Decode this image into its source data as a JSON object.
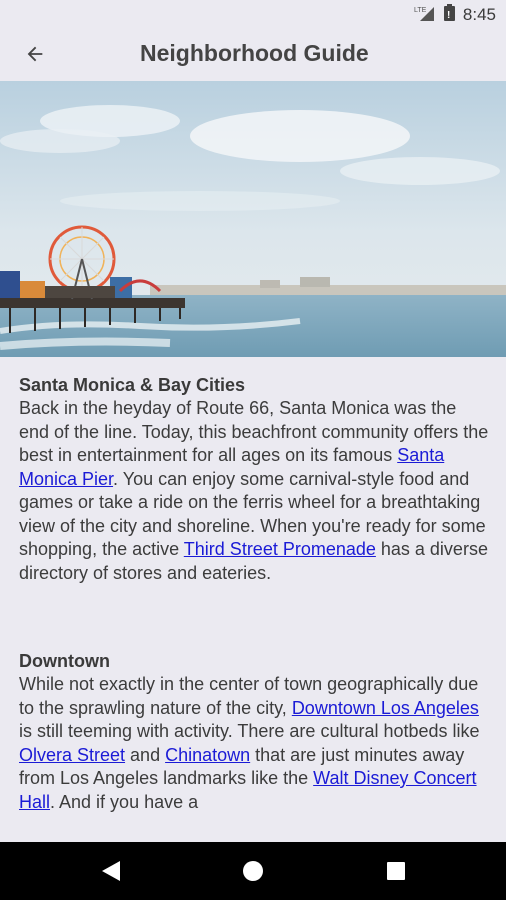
{
  "status_bar": {
    "time": "8:45",
    "icons": [
      "lte-signal-icon",
      "battery-icon"
    ]
  },
  "app_bar": {
    "title": "Neighborhood Guide",
    "back_icon": "arrow-back-icon"
  },
  "hero": {
    "description_icon": "beach-pier-photo"
  },
  "sections": [
    {
      "title": "Santa Monica & Bay Cities",
      "body": [
        {
          "t": "Back in the heyday of Route 66, Santa Monica was the end of the line. Today, this beachfront community offers the best in entertainment for all ages on its famous "
        },
        {
          "link": "Santa Monica Pier"
        },
        {
          "t": ". You can enjoy some carnival-style food and games or take a ride on the ferris wheel for a breathtaking view of the city and shoreline. When you're ready for some shopping, the active "
        },
        {
          "link": "Third Street Promenade"
        },
        {
          "t": " has a diverse directory of stores and eateries."
        }
      ]
    },
    {
      "title": "Downtown",
      "body": [
        {
          "t": "While not exactly in the center of town geographically due to the sprawling nature of the city, "
        },
        {
          "link": "Downtown Los Angeles"
        },
        {
          "t": " is still teeming with activity. There are cultural hotbeds like "
        },
        {
          "link": "Olvera Street"
        },
        {
          "t": " and "
        },
        {
          "link": "Chinatown"
        },
        {
          "t": " that are just minutes away from Los Angeles landmarks like the "
        },
        {
          "link": "Walt Disney Concert Hall"
        },
        {
          "t": ". And if you have a"
        }
      ]
    }
  ],
  "nav_bar": {
    "icons": [
      "back-triangle-icon",
      "home-circle-icon",
      "recents-square-icon"
    ]
  },
  "colors": {
    "background": "#ebeaf1",
    "link": "#1b1bd6",
    "nav_bar": "#000000"
  }
}
